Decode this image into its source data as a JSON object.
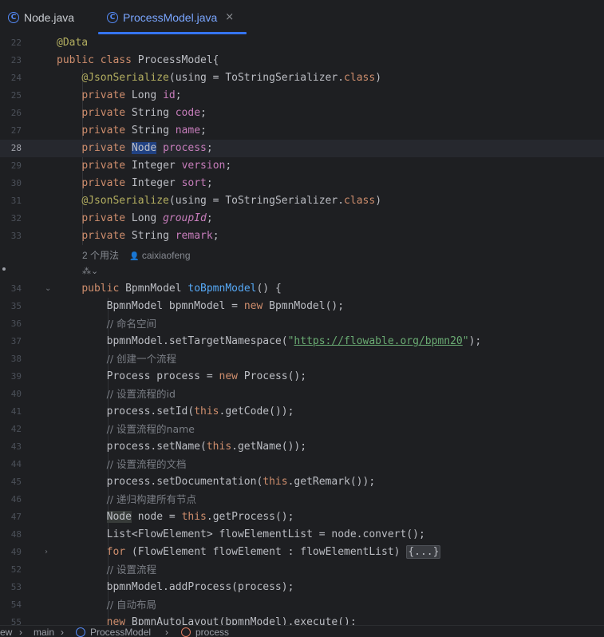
{
  "tabs": [
    {
      "label": "Node.java",
      "active": false
    },
    {
      "label": "ProcessModel.java",
      "active": true
    }
  ],
  "tab_close_glyph": "×",
  "tab_icon_letter": "C",
  "code_lines": [
    {
      "n": "22",
      "html": "<span class=\"an\">@Data</span>"
    },
    {
      "n": "23",
      "html": "<span class=\"kw\">public class</span> ProcessModel{"
    },
    {
      "n": "24",
      "html": "    <span class=\"an\">@JsonSerialize</span>(using = ToStringSerializer.<span class=\"kw\">class</span>)"
    },
    {
      "n": "25",
      "html": "    <span class=\"kw\">private</span> Long <span class=\"fld\">id</span>;"
    },
    {
      "n": "26",
      "html": "    <span class=\"kw\">private</span> String <span class=\"fld\">code</span>;"
    },
    {
      "n": "27",
      "html": "    <span class=\"kw\">private</span> String <span class=\"fld\">name</span>;"
    },
    {
      "n": "28",
      "html": "    <span class=\"kw\">private</span> <span class=\"sel\">Node</span> <span class=\"fld\">process</span>;",
      "current": true
    },
    {
      "n": "29",
      "html": "    <span class=\"kw\">private</span> Integer <span class=\"fld\">version</span>;"
    },
    {
      "n": "30",
      "html": "    <span class=\"kw\">private</span> Integer <span class=\"fld\">sort</span>;"
    },
    {
      "n": "31",
      "html": "    <span class=\"an\">@JsonSerialize</span>(using = ToStringSerializer.<span class=\"kw\">class</span>)"
    },
    {
      "n": "32",
      "html": "    <span class=\"kw\">private</span> Long <span class=\"fldi\">groupId</span>;"
    },
    {
      "n": "33",
      "html": "    <span class=\"kw\">private</span> String <span class=\"fld\">remark</span>;"
    },
    {
      "n": "34",
      "html": "    <span class=\"kw\">public</span> BpmnModel <span class=\"mdecl\">toBpmnModel</span>() {",
      "fold": "⌄"
    },
    {
      "n": "35",
      "html": "        BpmnModel bpmnModel = <span class=\"kw\">new</span> BpmnModel();"
    },
    {
      "n": "36",
      "html": "        <span class=\"cm\">// 命名空间</span>"
    },
    {
      "n": "37",
      "html": "        bpmnModel.setTargetNamespace(<span class=\"str\">\"</span><span class=\"url\">https://flowable.org/bpmn20</span><span class=\"str\">\"</span>);"
    },
    {
      "n": "38",
      "html": "        <span class=\"cm\">// 创建一个流程</span>"
    },
    {
      "n": "39",
      "html": "        Process process = <span class=\"kw\">new</span> Process();"
    },
    {
      "n": "40",
      "html": "        <span class=\"cm\">// 设置流程的id</span>"
    },
    {
      "n": "41",
      "html": "        process.setId(<span class=\"kw\">this</span>.getCode());"
    },
    {
      "n": "42",
      "html": "        <span class=\"cm\">// 设置流程的name</span>"
    },
    {
      "n": "43",
      "html": "        process.setName(<span class=\"kw\">this</span>.getName());"
    },
    {
      "n": "44",
      "html": "        <span class=\"cm\">// 设置流程的文档</span>"
    },
    {
      "n": "45",
      "html": "        process.setDocumentation(<span class=\"kw\">this</span>.getRemark());"
    },
    {
      "n": "46",
      "html": "        <span class=\"cm\">// 递归构建所有节点</span>"
    },
    {
      "n": "47",
      "html": "        <span class=\"hl\">Node</span> node = <span class=\"kw\">this</span>.getProcess();"
    },
    {
      "n": "48",
      "html": "        List&lt;FlowElement&gt; flowElementList = node.convert();"
    },
    {
      "n": "49",
      "html": "        <span class=\"kw\">for</span> (FlowElement flowElement : flowElementList) <span class=\"fold-ph\">{...}</span>",
      "fold": "›"
    },
    {
      "n": "52",
      "html": "        <span class=\"cm\">// 设置流程</span>"
    },
    {
      "n": "53",
      "html": "        bpmnModel.addProcess(process);"
    },
    {
      "n": "54",
      "html": "        <span class=\"cm\">// 自动布局</span>"
    },
    {
      "n": "55",
      "html": "        <span class=\"kw\">new</span> BpmnAutoLayout(bpmnModel).execute();"
    }
  ],
  "inlay": {
    "usages": "2 个用法",
    "author_icon": "person-icon",
    "author": "caixiaofeng",
    "second": "⁂⌄"
  },
  "breadcrumb": [
    "ew",
    "main",
    "ProcessModel",
    "process"
  ],
  "breadcrumb_sep": "›"
}
